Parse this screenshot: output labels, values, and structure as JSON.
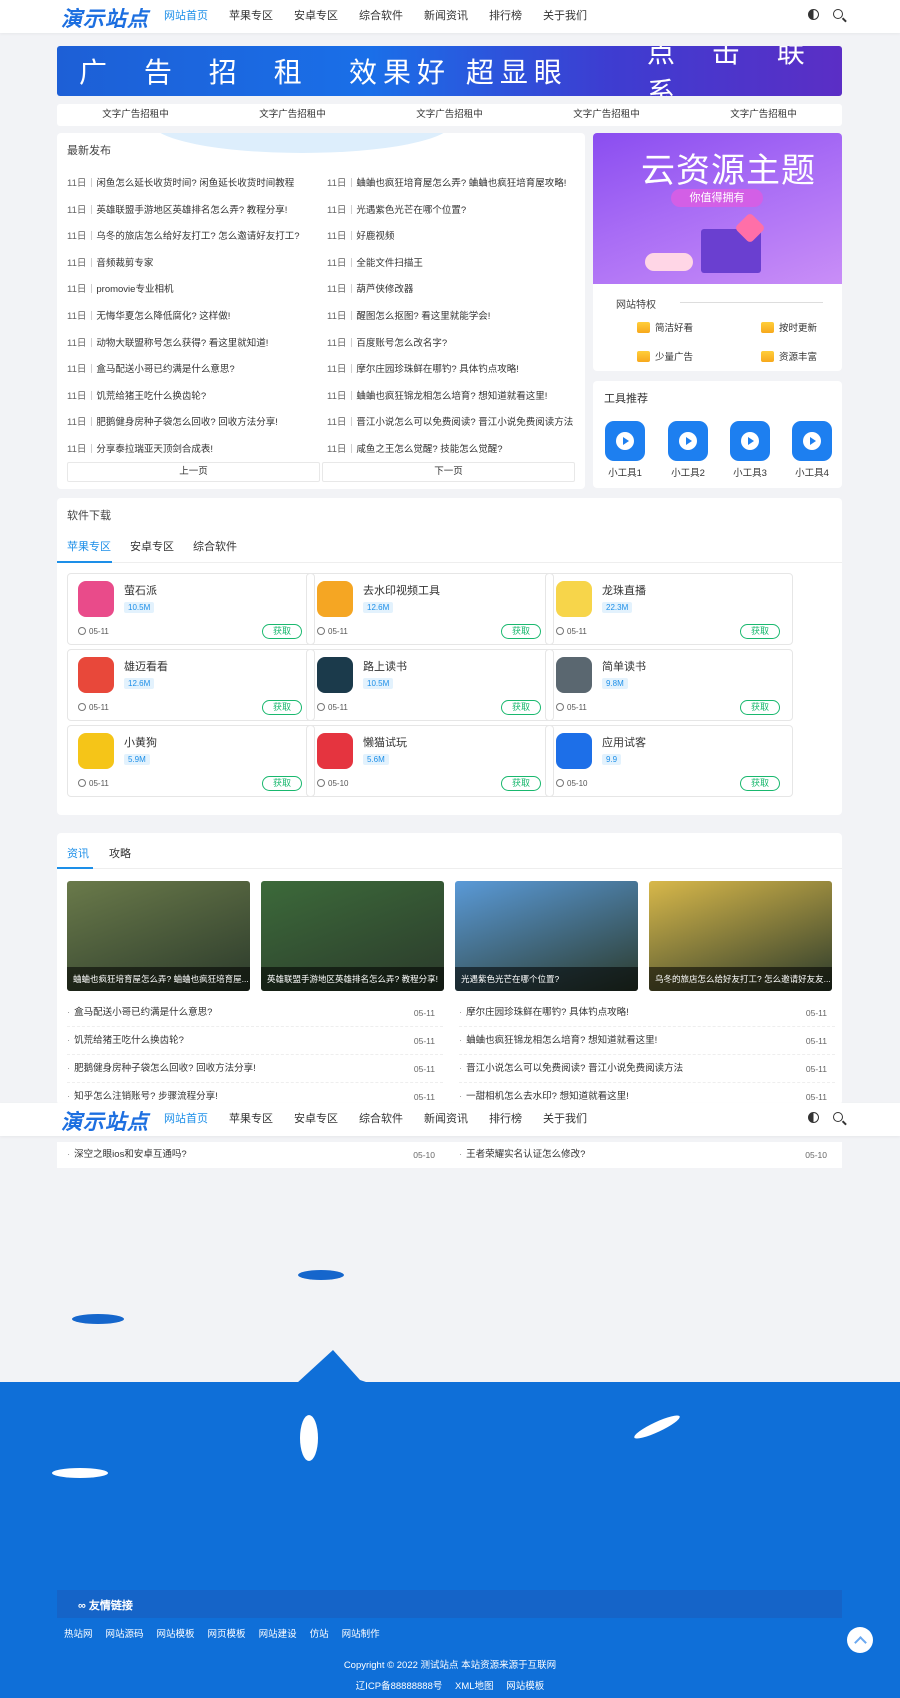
{
  "header": {
    "logo": "演示站点",
    "nav": [
      "网站首页",
      "苹果专区",
      "安卓专区",
      "综合软件",
      "新闻资讯",
      "排行榜",
      "关于我们"
    ]
  },
  "banner": {
    "left": "广 告 招 租",
    "mid": "效果好 超显眼",
    "right": "点 击 联 系"
  },
  "text_ads": [
    "文字广告招租中",
    "文字广告招租中",
    "文字广告招租中",
    "文字广告招租中",
    "文字广告招租中"
  ],
  "latest": {
    "title": "最新发布",
    "left": [
      {
        "d": "11日",
        "t": "闲鱼怎么延长收货时间? 闲鱼延长收货时间教程"
      },
      {
        "d": "11日",
        "t": "英雄联盟手游地区英雄排名怎么弄? 教程分享!"
      },
      {
        "d": "11日",
        "t": "乌冬的旅店怎么给好友打工? 怎么邀请好友打工?"
      },
      {
        "d": "11日",
        "t": "音频裁剪专家"
      },
      {
        "d": "11日",
        "t": "promovie专业相机"
      },
      {
        "d": "11日",
        "t": "无悔华夏怎么降低腐化? 这样做!"
      },
      {
        "d": "11日",
        "t": "动物大联盟称号怎么获得? 看这里就知道!"
      },
      {
        "d": "11日",
        "t": "盒马配送小哥已约满是什么意思?"
      },
      {
        "d": "11日",
        "t": "饥荒给猪王吃什么换齿轮?"
      },
      {
        "d": "11日",
        "t": "肥鹅健身房种子袋怎么回收? 回收方法分享!"
      },
      {
        "d": "11日",
        "t": "分享泰拉瑞亚天顶剑合成表!"
      }
    ],
    "right": [
      {
        "d": "11日",
        "t": "蛐蛐也疯狂培育屋怎么弄? 蛐蛐也疯狂培育屋攻略!"
      },
      {
        "d": "11日",
        "t": "光遇紫色光芒在哪个位置?"
      },
      {
        "d": "11日",
        "t": "好鹿视频"
      },
      {
        "d": "11日",
        "t": "全能文件扫描王"
      },
      {
        "d": "11日",
        "t": "葫芦侠修改器"
      },
      {
        "d": "11日",
        "t": "醒图怎么抠图? 看这里就能学会!"
      },
      {
        "d": "11日",
        "t": "百度账号怎么改名字?"
      },
      {
        "d": "11日",
        "t": "摩尔庄园珍珠鲜在哪钓? 具体钓点攻略!"
      },
      {
        "d": "11日",
        "t": "蛐蛐也疯狂锦龙相怎么培育? 想知道就看这里!"
      },
      {
        "d": "11日",
        "t": "晋江小说怎么可以免费阅读? 晋江小说免费阅读方法"
      },
      {
        "d": "11日",
        "t": "咸鱼之王怎么觉醒? 技能怎么觉醒?"
      }
    ],
    "prev": "上一页",
    "next": "下一页"
  },
  "promo": {
    "title": "云资源主题",
    "tag": "你值得拥有"
  },
  "features": {
    "title": "网站特权",
    "items": [
      "简洁好看",
      "按时更新",
      "少量广告",
      "资源丰富"
    ]
  },
  "tools": {
    "title": "工具推荐",
    "items": [
      "小工具1",
      "小工具2",
      "小工具3",
      "小工具4"
    ]
  },
  "software": {
    "title": "软件下载",
    "tabs": [
      "苹果专区",
      "安卓专区",
      "综合软件"
    ],
    "get_label": "获取",
    "apps": [
      {
        "name": "萤石派",
        "size": "10.5M",
        "date": "05-11",
        "color": "#e94b8a"
      },
      {
        "name": "去水印视频工具",
        "size": "12.6M",
        "date": "05-11",
        "color": "#f5a623"
      },
      {
        "name": "龙珠直播",
        "size": "22.3M",
        "date": "05-11",
        "color": "#f7d54a"
      },
      {
        "name": "雄迈看看",
        "size": "12.6M",
        "date": "05-11",
        "color": "#e8483a"
      },
      {
        "name": "路上读书",
        "size": "10.5M",
        "date": "05-11",
        "color": "#1b3a4b"
      },
      {
        "name": "简单读书",
        "size": "9.8M",
        "date": "05-11",
        "color": "#5a6770"
      },
      {
        "name": "小黄狗",
        "size": "5.9M",
        "date": "05-11",
        "color": "#f5c518"
      },
      {
        "name": "懒猫试玩",
        "size": "5.6M",
        "date": "05-10",
        "color": "#e5343f"
      },
      {
        "name": "应用试客",
        "size": "9.9",
        "date": "05-10",
        "color": "#1d6fe8"
      }
    ]
  },
  "news": {
    "tabs": [
      "资讯",
      "攻略"
    ],
    "thumbs": [
      {
        "caption": "蛐蛐也疯狂培育屋怎么弄? 蛐蛐也疯狂培育屋...",
        "color": "#6a7a4a"
      },
      {
        "caption": "英雄联盟手游地区英雄排名怎么弄? 教程分享!",
        "color": "#3c6a3a"
      },
      {
        "caption": "光遇紫色光芒在哪个位置?",
        "color": "#5a9ad8"
      },
      {
        "caption": "乌冬的旅店怎么给好友打工? 怎么邀请好友友...",
        "color": "#d8b84a"
      }
    ],
    "left": [
      {
        "t": "盒马配送小哥已约满是什么意思?",
        "d": "05-11"
      },
      {
        "t": "饥荒给猪王吃什么换齿轮?",
        "d": "05-11"
      },
      {
        "t": "肥鹅健身房种子袋怎么回收? 回收方法分享!",
        "d": "05-11"
      },
      {
        "t": "知乎怎么注销账号? 步骤流程分享!",
        "d": "05-11"
      }
    ],
    "right": [
      {
        "t": "摩尔庄园珍珠鲜在哪钓? 具体钓点攻略!",
        "d": "05-11"
      },
      {
        "t": "蛐蛐也疯狂锦龙相怎么培育? 想知道就看这里!",
        "d": "05-11"
      },
      {
        "t": "晋江小说怎么可以免费阅读? 晋江小说免费阅读方法",
        "d": "05-11"
      },
      {
        "t": "一甜相机怎么去水印? 想知道就看这里!",
        "d": "05-11"
      }
    ],
    "extra_left": {
      "t": "深空之眼ios和安卓互通吗?",
      "d": "05-10"
    },
    "extra_right": {
      "t": "王者荣耀实名认证怎么修改?",
      "d": "05-10"
    }
  },
  "footer": {
    "friend_title": "友情链接",
    "links": [
      "热站网",
      "网站源码",
      "网站模板",
      "网页模板",
      "网站建设",
      "仿站",
      "网站制作"
    ],
    "copyright": "Copyright © 2022 测试站点 本站资源来源于互联网",
    "icp": "辽ICP备88888888号",
    "sitemap": "XML地图",
    "template": "网站模板"
  },
  "colors": {
    "accent": "#1d8fe8",
    "ocean": "#0f6fd8",
    "get": "#19b86e"
  }
}
